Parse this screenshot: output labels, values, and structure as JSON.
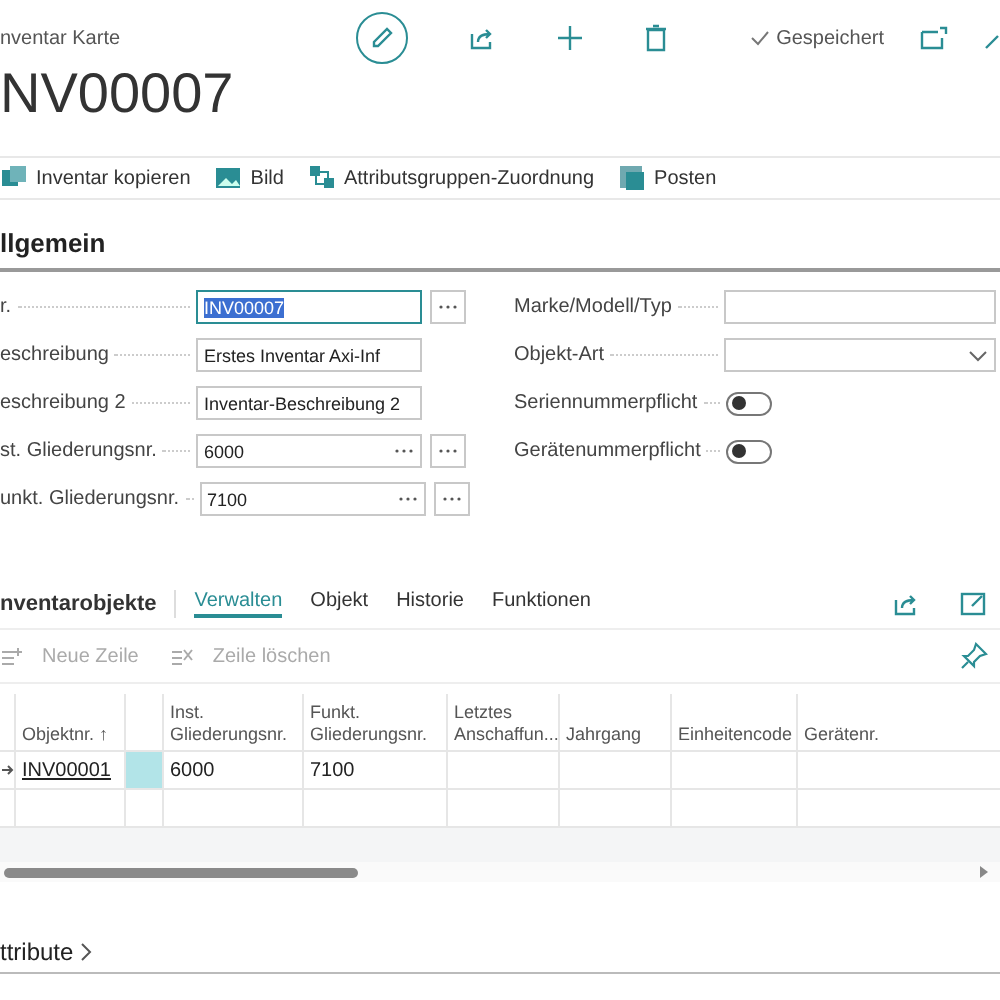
{
  "header": {
    "breadcrumb": "nventar Karte",
    "title": "NV00007",
    "status": "Gespeichert"
  },
  "actions": [
    {
      "label": "Inventar kopieren",
      "kind": "copy"
    },
    {
      "label": "Bild",
      "kind": "image"
    },
    {
      "label": "Attributsgruppen-Zuordnung",
      "kind": "assign"
    },
    {
      "label": "Posten",
      "kind": "entries"
    }
  ],
  "general": {
    "title": "llgemein",
    "left_fields": [
      {
        "label": "r.",
        "value": "INV00007",
        "kind": "lookup",
        "focused": true
      },
      {
        "label": "eschreibung",
        "value": "Erstes Inventar Axi-Inf",
        "kind": "text",
        "focused": false
      },
      {
        "label": "eschreibung 2",
        "value": "Inventar-Beschreibung 2",
        "kind": "text",
        "focused": false
      },
      {
        "label": "st. Gliederungsnr.",
        "value": "6000",
        "kind": "dual",
        "focused": false
      },
      {
        "label": "unkt. Gliederungsnr.",
        "value": "7100",
        "kind": "dual",
        "focused": false
      }
    ],
    "right_fields": [
      {
        "label": "Marke/Modell/Typ",
        "kind": "text"
      },
      {
        "label": "Objekt-Art",
        "kind": "dropdown"
      },
      {
        "label": "Seriennummerpflicht",
        "kind": "toggle",
        "on": false
      },
      {
        "label": "Gerätenummerpflicht",
        "kind": "toggle",
        "on": false
      }
    ]
  },
  "lines": {
    "title": "nventarobjekte",
    "tabs": [
      {
        "label": "Verwalten",
        "selected": true
      },
      {
        "label": "Objekt",
        "selected": false
      },
      {
        "label": "Historie",
        "selected": false
      },
      {
        "label": "Funktionen",
        "selected": false
      }
    ],
    "tools": [
      {
        "label": "Neue Zeile",
        "kind": "new",
        "disabled": true
      },
      {
        "label": "Zeile löschen",
        "kind": "delete",
        "disabled": true
      }
    ],
    "columns": [
      "Objektnr. ↑",
      "",
      "Inst. Gliederungsnr.",
      "Funkt. Gliederungsnr.",
      "Letztes Anschaffun...",
      "Jahrgang",
      "Einheitencode",
      "Gerätenr."
    ],
    "rows": [
      {
        "selected": true,
        "cells": [
          "INV00001",
          "",
          "6000",
          "7100",
          "",
          "",
          "",
          ""
        ]
      }
    ]
  },
  "attributes": {
    "title": "ttribute"
  }
}
